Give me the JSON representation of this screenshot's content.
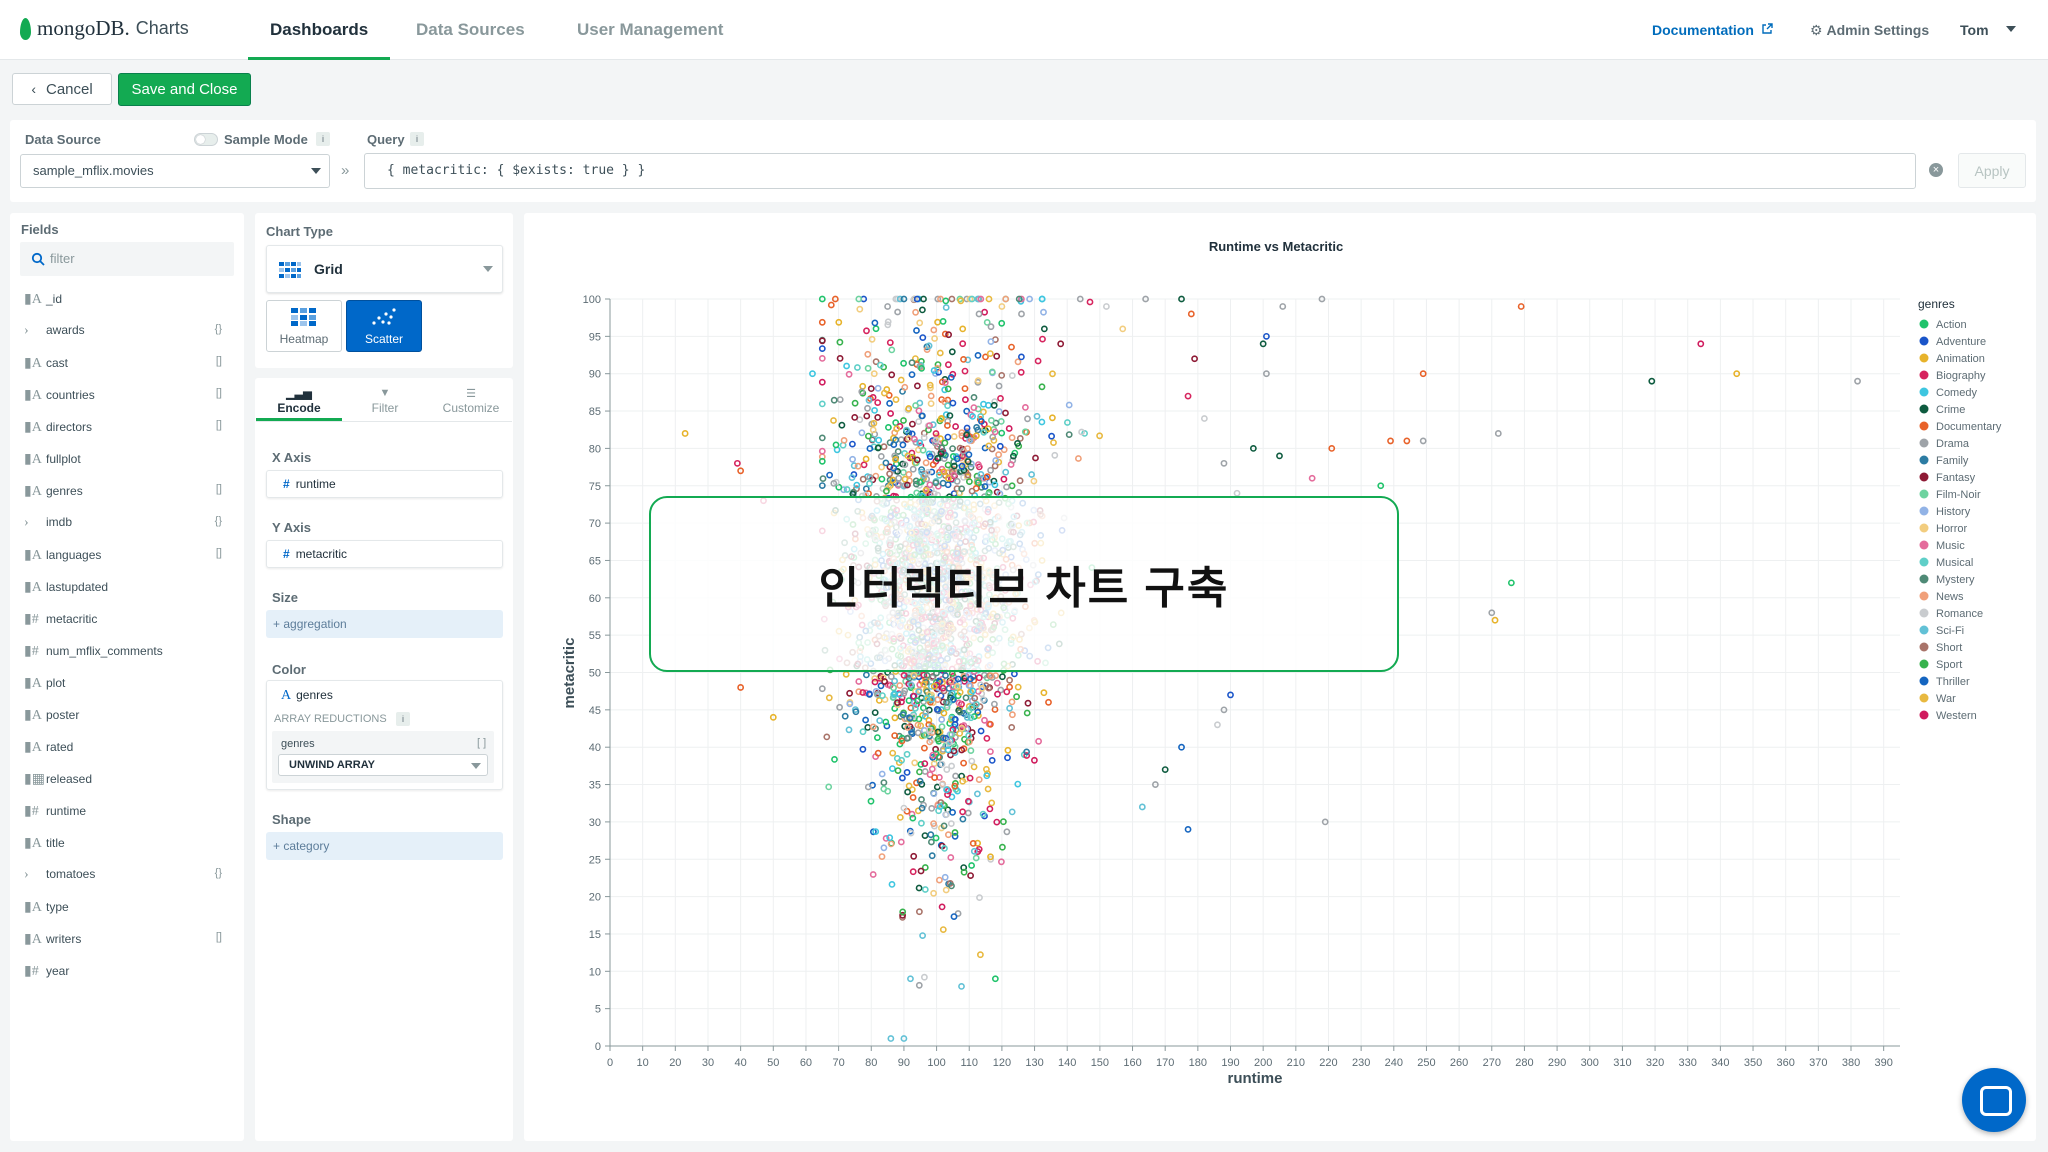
{
  "app": {
    "brand": "mongoDB.",
    "product": "Charts"
  },
  "nav": {
    "tabs": [
      "Dashboards",
      "Data Sources",
      "User Management"
    ],
    "documentation": "Documentation",
    "admin_settings": "Admin Settings",
    "user": "Tom"
  },
  "toolbar": {
    "cancel": "Cancel",
    "save_close": "Save and Close"
  },
  "datasource": {
    "label": "Data Source",
    "sample_mode": "Sample Mode",
    "value": "sample_mflix.movies",
    "query_label": "Query",
    "query_text": "{ metacritic: { $exists: true } }",
    "apply": "Apply"
  },
  "fields": {
    "title": "Fields",
    "filter_placeholder": "filter",
    "items": [
      {
        "name": "_id",
        "icon": "A"
      },
      {
        "name": "awards",
        "icon": ">",
        "suffix": "{}"
      },
      {
        "name": "cast",
        "icon": "A",
        "suffix": "[]"
      },
      {
        "name": "countries",
        "icon": "A",
        "suffix": "[]"
      },
      {
        "name": "directors",
        "icon": "A",
        "suffix": "[]"
      },
      {
        "name": "fullplot",
        "icon": "A"
      },
      {
        "name": "genres",
        "icon": "A",
        "suffix": "[]"
      },
      {
        "name": "imdb",
        "icon": ">",
        "suffix": "{}"
      },
      {
        "name": "languages",
        "icon": "A",
        "suffix": "[]"
      },
      {
        "name": "lastupdated",
        "icon": "A"
      },
      {
        "name": "metacritic",
        "icon": "#"
      },
      {
        "name": "num_mflix_comments",
        "icon": "#"
      },
      {
        "name": "plot",
        "icon": "A"
      },
      {
        "name": "poster",
        "icon": "A"
      },
      {
        "name": "rated",
        "icon": "A"
      },
      {
        "name": "released",
        "icon": "calendar"
      },
      {
        "name": "runtime",
        "icon": "#"
      },
      {
        "name": "title",
        "icon": "A"
      },
      {
        "name": "tomatoes",
        "icon": ">",
        "suffix": "{}"
      },
      {
        "name": "type",
        "icon": "A"
      },
      {
        "name": "writers",
        "icon": "A",
        "suffix": "[]"
      },
      {
        "name": "year",
        "icon": "#"
      }
    ]
  },
  "builder": {
    "chart_type_label": "Chart Type",
    "chart_type": "Grid",
    "heatmap": "Heatmap",
    "scatter": "Scatter",
    "tabs": [
      "Encode",
      "Filter",
      "Customize"
    ],
    "x_axis_label": "X Axis",
    "x_axis_field": "runtime",
    "y_axis_label": "Y Axis",
    "y_axis_field": "metacritic",
    "size_label": "Size",
    "size_placeholder": "+ aggregation",
    "color_label": "Color",
    "color_field": "genres",
    "array_reductions": "ARRAY REDUCTIONS",
    "reduction_field": "genres",
    "reduction_value": "UNWIND ARRAY",
    "shape_label": "Shape",
    "shape_placeholder": "+ category"
  },
  "overlay_text": "인터랙티브 차트 구축",
  "chart_data": {
    "type": "scatter",
    "title": "Runtime vs Metacritic",
    "xlabel": "runtime",
    "ylabel": "metacritic",
    "xlim": [
      0,
      395
    ],
    "ylim": [
      0,
      100
    ],
    "xticks": [
      0,
      10,
      20,
      30,
      40,
      50,
      60,
      70,
      80,
      90,
      100,
      110,
      120,
      130,
      140,
      150,
      160,
      170,
      180,
      190,
      200,
      210,
      220,
      230,
      240,
      250,
      260,
      270,
      280,
      290,
      300,
      310,
      320,
      330,
      340,
      350,
      360,
      370,
      380,
      390
    ],
    "yticks": [
      0,
      5,
      10,
      15,
      20,
      25,
      30,
      35,
      40,
      45,
      50,
      55,
      60,
      65,
      70,
      75,
      80,
      85,
      90,
      95,
      100
    ],
    "legend_title": "genres",
    "legend_position": "right",
    "grid": true,
    "series": [
      {
        "name": "Action",
        "color": "#20c36b"
      },
      {
        "name": "Adventure",
        "color": "#1a55c9"
      },
      {
        "name": "Animation",
        "color": "#e7b32b"
      },
      {
        "name": "Biography",
        "color": "#d6245e"
      },
      {
        "name": "Comedy",
        "color": "#3ec6e0"
      },
      {
        "name": "Crime",
        "color": "#0e5b3f"
      },
      {
        "name": "Documentary",
        "color": "#e8622a"
      },
      {
        "name": "Drama",
        "color": "#9ea3a8"
      },
      {
        "name": "Family",
        "color": "#2c7ca3"
      },
      {
        "name": "Fantasy",
        "color": "#8e1a35"
      },
      {
        "name": "Film-Noir",
        "color": "#6ed3a0"
      },
      {
        "name": "History",
        "color": "#92b3e6"
      },
      {
        "name": "Horror",
        "color": "#f2cd7f"
      },
      {
        "name": "Music",
        "color": "#e46c9c"
      },
      {
        "name": "Musical",
        "color": "#5fcfc8"
      },
      {
        "name": "Mystery",
        "color": "#4f8a76"
      },
      {
        "name": "News",
        "color": "#f0a07a"
      },
      {
        "name": "Romance",
        "color": "#c9cccf"
      },
      {
        "name": "Sci-Fi",
        "color": "#62c1d6"
      },
      {
        "name": "Short",
        "color": "#a9746a"
      },
      {
        "name": "Sport",
        "color": "#37b24d"
      },
      {
        "name": "Thriller",
        "color": "#1565c0"
      },
      {
        "name": "War",
        "color": "#e8b940"
      },
      {
        "name": "Western",
        "color": "#d01c5e"
      }
    ],
    "sample_points": [
      [
        23,
        82,
        "Animation"
      ],
      [
        39,
        78,
        "Biography"
      ],
      [
        40,
        77,
        "Documentary"
      ],
      [
        47,
        73,
        "Biography"
      ],
      [
        40,
        48,
        "Documentary"
      ],
      [
        50,
        44,
        "Animation"
      ],
      [
        62,
        90,
        "Comedy"
      ],
      [
        69,
        100,
        "Documentary"
      ],
      [
        76,
        62,
        "Drama"
      ],
      [
        80,
        88,
        "Fantasy"
      ],
      [
        85,
        99,
        "Drama"
      ],
      [
        90,
        100,
        "Family"
      ],
      [
        96,
        100,
        "Crime"
      ],
      [
        102,
        97,
        "Action"
      ],
      [
        108,
        96,
        "Animation"
      ],
      [
        113,
        98,
        "Drama"
      ],
      [
        120,
        99,
        "Horror"
      ],
      [
        126,
        98,
        "Drama"
      ],
      [
        133,
        96,
        "Crime"
      ],
      [
        138,
        94,
        "Fantasy"
      ],
      [
        144,
        100,
        "Drama"
      ],
      [
        152,
        99,
        "Romance"
      ],
      [
        157,
        96,
        "Horror"
      ],
      [
        164,
        100,
        "Drama"
      ],
      [
        175,
        100,
        "Crime"
      ],
      [
        178,
        98,
        "Documentary"
      ],
      [
        179,
        92,
        "Fantasy"
      ],
      [
        177,
        87,
        "Biography"
      ],
      [
        182,
        84,
        "Romance"
      ],
      [
        188,
        78,
        "Drama"
      ],
      [
        192,
        74,
        "Romance"
      ],
      [
        201,
        90,
        "Drama"
      ],
      [
        200,
        94,
        "Crime"
      ],
      [
        201,
        95,
        "Adventure"
      ],
      [
        206,
        99,
        "Drama"
      ],
      [
        218,
        100,
        "Drama"
      ],
      [
        197,
        80,
        "Crime"
      ],
      [
        205,
        79,
        "Crime"
      ],
      [
        215,
        76,
        "Music"
      ],
      [
        221,
        80,
        "Documentary"
      ],
      [
        236,
        75,
        "Action"
      ],
      [
        239,
        81,
        "Documentary"
      ],
      [
        244,
        81,
        "Documentary"
      ],
      [
        249,
        90,
        "Documentary"
      ],
      [
        249,
        81,
        "Drama"
      ],
      [
        270,
        58,
        "Drama"
      ],
      [
        271,
        57,
        "Animation"
      ],
      [
        276,
        62,
        "Action"
      ],
      [
        272,
        82,
        "Drama"
      ],
      [
        279,
        99,
        "Documentary"
      ],
      [
        319,
        89,
        "Crime"
      ],
      [
        334,
        94,
        "Western"
      ],
      [
        345,
        90,
        "Animation"
      ],
      [
        382,
        89,
        "Drama"
      ],
      [
        190,
        47,
        "Adventure"
      ],
      [
        188,
        45,
        "Drama"
      ],
      [
        186,
        43,
        "Romance"
      ],
      [
        175,
        40,
        "Thriller"
      ],
      [
        170,
        37,
        "Crime"
      ],
      [
        167,
        35,
        "Drama"
      ],
      [
        163,
        32,
        "Sci-Fi"
      ],
      [
        177,
        29,
        "Thriller"
      ],
      [
        219,
        30,
        "Drama"
      ],
      [
        86,
        1,
        "Sci-Fi"
      ],
      [
        90,
        1,
        "Sci-Fi"
      ],
      [
        92,
        9,
        "Sci-Fi"
      ],
      [
        118,
        9,
        "Action"
      ]
    ]
  }
}
